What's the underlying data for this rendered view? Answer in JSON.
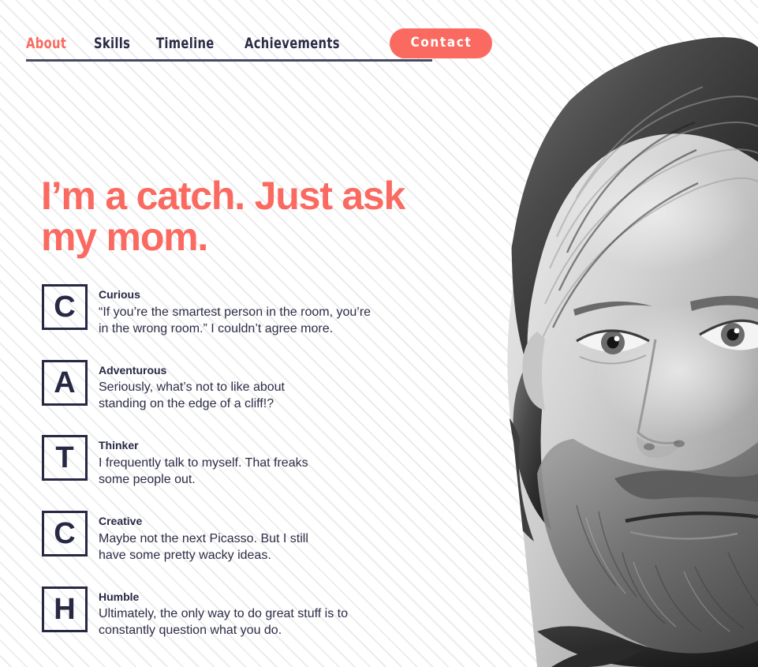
{
  "nav": {
    "items": [
      {
        "label": "About",
        "active": true
      },
      {
        "label": "Skills",
        "active": false
      },
      {
        "label": "Timeline",
        "active": false
      },
      {
        "label": "Achievements",
        "active": false
      }
    ],
    "contact_label": "Contact"
  },
  "hero": {
    "headline": "I’m a catch. Just\nask my mom."
  },
  "traits": [
    {
      "letter": "C",
      "title": "Curious",
      "description": "“If you’re the smartest person in the room, you’re\nin the wrong room.” I couldn’t agree more."
    },
    {
      "letter": "A",
      "title": "Adventurous",
      "description": "Seriously, what’s not to like about\nstanding on the edge of a cliff!?"
    },
    {
      "letter": "T",
      "title": "Thinker",
      "description": "I frequently talk to myself. That freaks\nsome people out."
    },
    {
      "letter": "C",
      "title": "Creative",
      "description": "Maybe not the next Picasso. But I still\nhave some pretty wacky ideas."
    },
    {
      "letter": "H",
      "title": "Humble",
      "description": "Ultimately, the only way to do great stuff is to\nconstantly question what you do."
    }
  ],
  "portrait": {
    "alt": "black-and-white portrait photo of a bearded man with wavy hair"
  },
  "colors": {
    "accent": "#fa6a61",
    "ink": "#272844",
    "rule": "#474a63",
    "page_background": "#fdfdfd",
    "stripe": "#ececec"
  }
}
